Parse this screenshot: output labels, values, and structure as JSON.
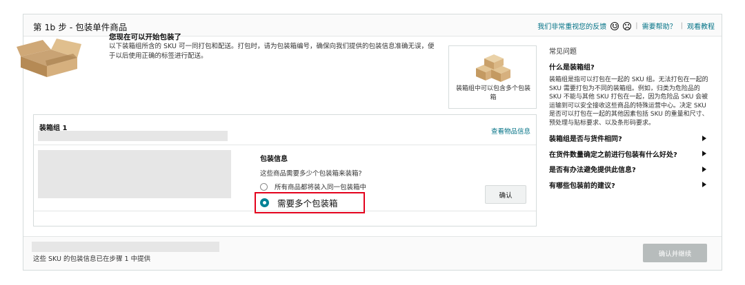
{
  "header": {
    "title": "第 1b 步 - 包装单件商品",
    "feedback": "我们非常重视您的反馈",
    "help": "需要帮助？",
    "tutorial": "观看教程",
    "separator": "|"
  },
  "intro": {
    "title": "您现在可以开始包装了",
    "text": "以下装箱组所含的 SKU 可一同打包和配送。打包时，请为包装箱编号，确保向我们提供的包装信息准确无误，便于以后使用正确的标签进行配送。"
  },
  "tip_card": {
    "text": "装箱组中可以包含多个包装箱"
  },
  "group": {
    "title": "装箱组 1",
    "view_link": "查看物品信息"
  },
  "packing": {
    "title": "包装信息",
    "question": "这些商品需要多少个包装箱来装箱?",
    "option1": "所有商品都将装入同一包装箱中",
    "option2": "需要多个包装箱",
    "selected": "option2",
    "confirm": "确认"
  },
  "faq": {
    "heading": "常见问题",
    "q1": "什么是装箱组?",
    "a1": "装箱组是指可以打包在一起的 SKU 组。无法打包在一起的 SKU 需要打包为不同的装箱组。例如，归类为危险品的 SKU 不能与其他 SKU 打包在一起，因为危险品 SKU 会被运输到可以安全接收这些商品的特殊运营中心。决定 SKU 是否可以打包在一起的其他因素包括 SKU 的重量和尺寸、预处理与贴标要求、以及条形码要求。",
    "items": [
      {
        "label": "装箱组是否与货件相同?"
      },
      {
        "label": "在货件数量确定之前进行包装有什么好处?"
      },
      {
        "label": "是否有办法避免提供此信息?"
      },
      {
        "label": "有哪些包装前的建议?"
      }
    ]
  },
  "footer": {
    "note": "这些 SKU 的包装信息已在步骤 1 中提供",
    "confirm_continue": "确认并继续"
  },
  "colors": {
    "link": "#007185",
    "radio_selected": "#008296",
    "highlight_border": "#e3001b",
    "disabled_button": "#b7bcbc"
  }
}
